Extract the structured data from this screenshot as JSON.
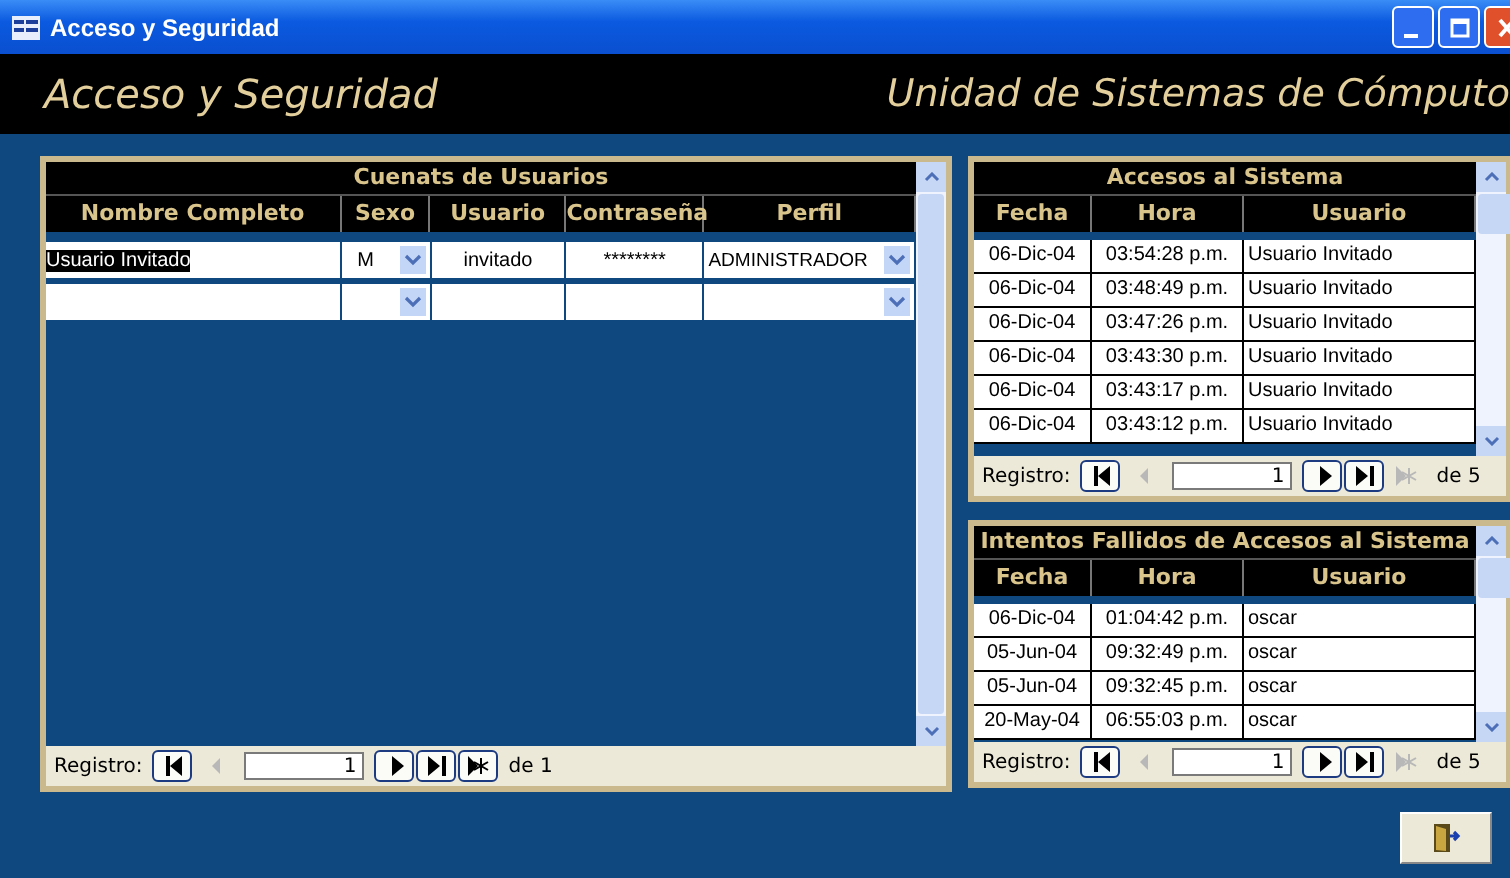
{
  "window": {
    "title": "Acceso y Seguridad"
  },
  "header": {
    "title": "Acceso y Seguridad",
    "subtitle": "Unidad de Sistemas de Cómputo"
  },
  "accounts": {
    "title": "Cuenats de Usuarios",
    "columns": [
      "Nombre Completo",
      "Sexo",
      "Usuario",
      "Contraseña",
      "Perfil"
    ],
    "rows": [
      {
        "nombre": "Usuario Invitado",
        "nombre_selected": true,
        "sexo": "M",
        "usuario": "invitado",
        "contrasena": "********",
        "perfil": "ADMINISTRADOR"
      }
    ],
    "new_record_row": true,
    "navigator": {
      "label": "Registro:",
      "record": "1",
      "total": "de 1",
      "buttons": [
        {
          "kind": "first",
          "disabled": false
        },
        {
          "kind": "prev",
          "disabled": true
        },
        {
          "kind": "next",
          "disabled": false
        },
        {
          "kind": "last",
          "disabled": false
        },
        {
          "kind": "new",
          "disabled": false
        }
      ]
    }
  },
  "logs": [
    {
      "title": "Accesos al Sistema",
      "columns": [
        "Fecha",
        "Hora",
        "Usuario"
      ],
      "rows": [
        {
          "fecha": "06-Dic-04",
          "hora": "03:54:28 p.m.",
          "usuario": "Usuario Invitado"
        },
        {
          "fecha": "06-Dic-04",
          "hora": "03:48:49 p.m.",
          "usuario": "Usuario Invitado"
        },
        {
          "fecha": "06-Dic-04",
          "hora": "03:47:26 p.m.",
          "usuario": "Usuario Invitado"
        },
        {
          "fecha": "06-Dic-04",
          "hora": "03:43:30 p.m.",
          "usuario": "Usuario Invitado"
        },
        {
          "fecha": "06-Dic-04",
          "hora": "03:43:17 p.m.",
          "usuario": "Usuario Invitado"
        },
        {
          "fecha": "06-Dic-04",
          "hora": "03:43:12 p.m.",
          "usuario": "Usuario Invitado"
        }
      ],
      "navigator": {
        "label": "Registro:",
        "record": "1",
        "total": "de 5",
        "buttons": [
          {
            "kind": "first",
            "disabled": false
          },
          {
            "kind": "prev",
            "disabled": true
          },
          {
            "kind": "next",
            "disabled": false
          },
          {
            "kind": "last",
            "disabled": false
          },
          {
            "kind": "new",
            "disabled": true
          }
        ]
      }
    },
    {
      "title": "Intentos Fallidos de Accesos al Sistema",
      "columns": [
        "Fecha",
        "Hora",
        "Usuario"
      ],
      "rows": [
        {
          "fecha": "06-Dic-04",
          "hora": "01:04:42 p.m.",
          "usuario": "oscar"
        },
        {
          "fecha": "05-Jun-04",
          "hora": "09:32:49 p.m.",
          "usuario": "oscar"
        },
        {
          "fecha": "05-Jun-04",
          "hora": "09:32:45 p.m.",
          "usuario": "oscar"
        },
        {
          "fecha": "20-May-04",
          "hora": "06:55:03 p.m.",
          "usuario": "oscar"
        }
      ],
      "navigator": {
        "label": "Registro:",
        "record": "1",
        "total": "de 5",
        "buttons": [
          {
            "kind": "first",
            "disabled": false
          },
          {
            "kind": "prev",
            "disabled": true
          },
          {
            "kind": "next",
            "disabled": false
          },
          {
            "kind": "last",
            "disabled": false
          },
          {
            "kind": "new",
            "disabled": true
          }
        ]
      }
    }
  ]
}
